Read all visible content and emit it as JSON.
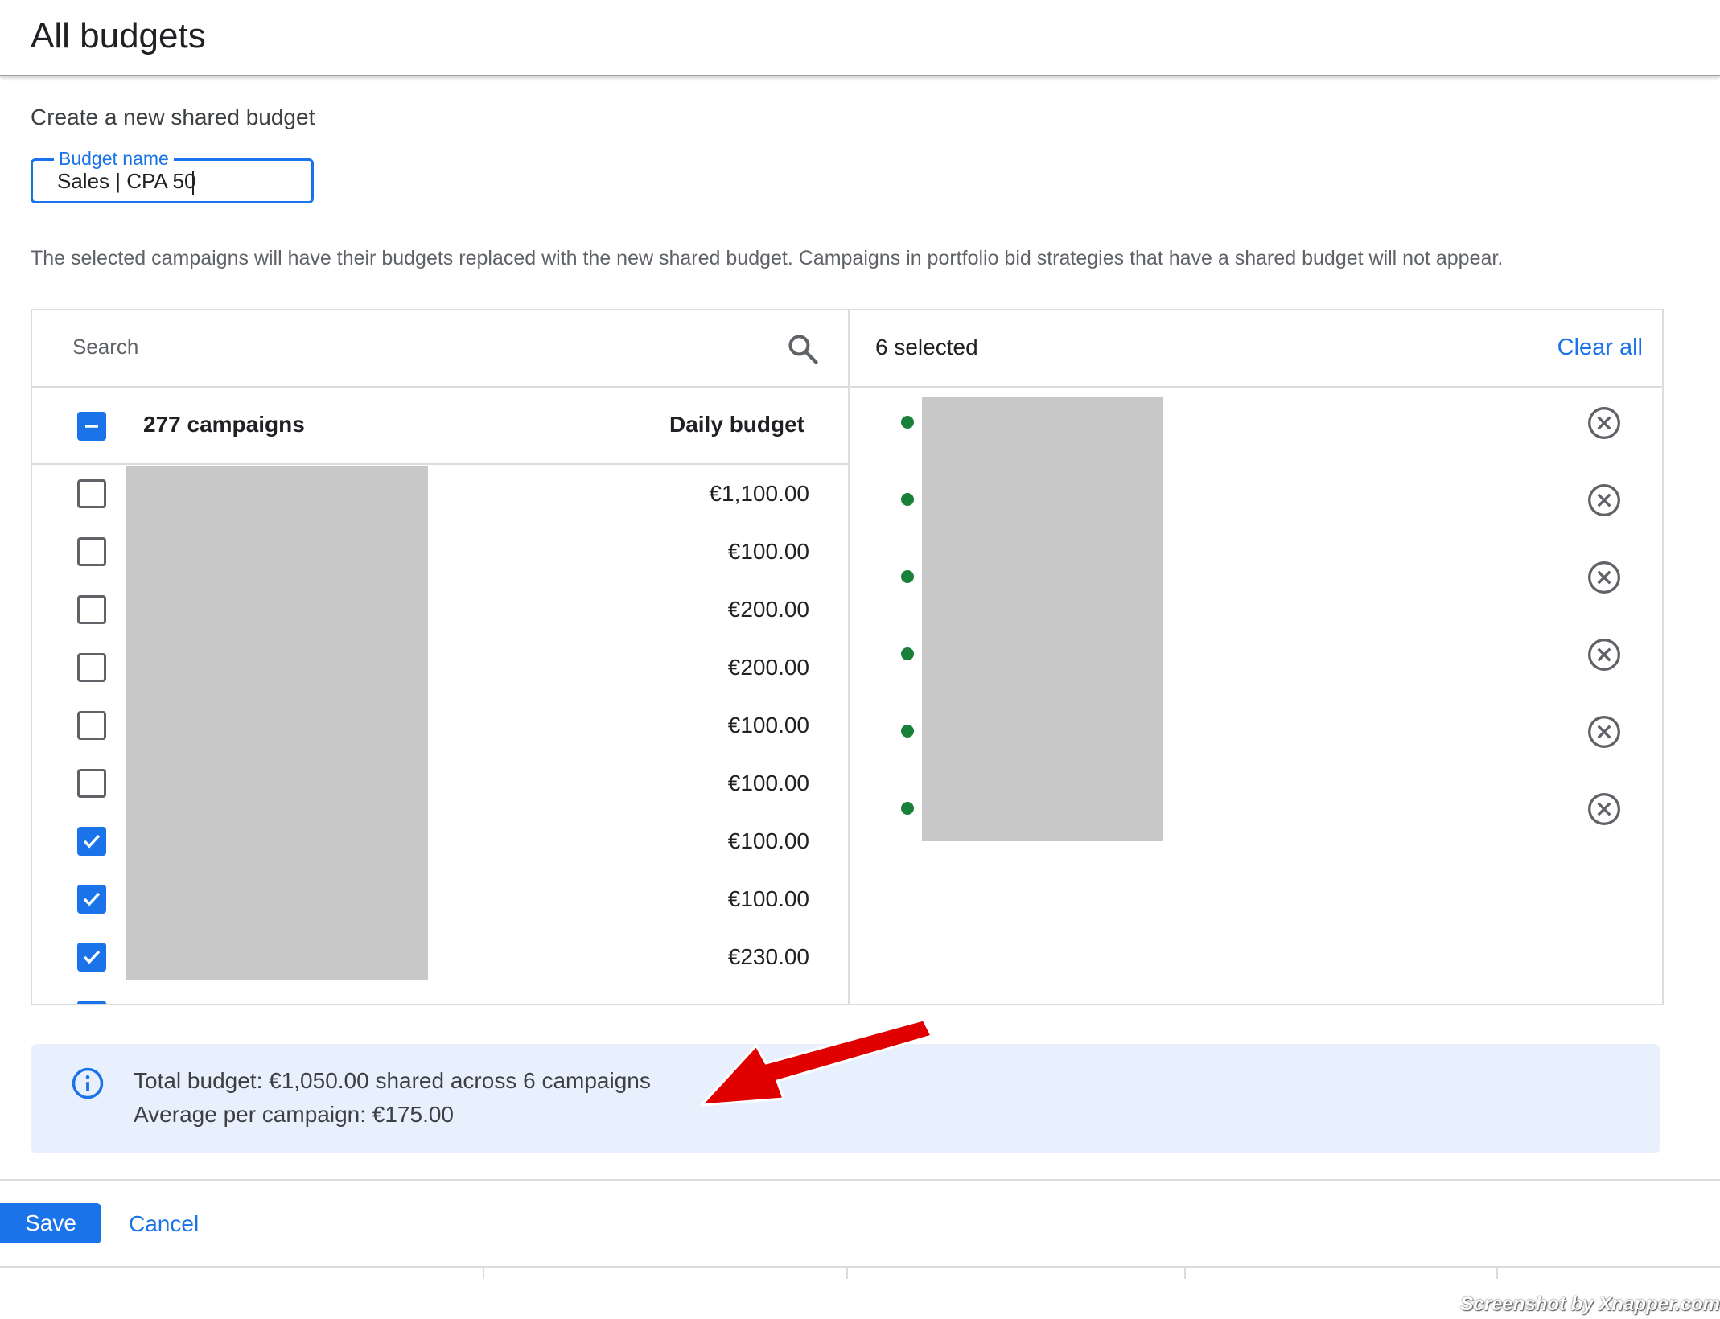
{
  "header": {
    "title": "All budgets"
  },
  "form": {
    "subtitle": "Create a new shared budget",
    "budget_name_label": "Budget name",
    "budget_name_value": "Sales | CPA 50",
    "info_text": "The selected campaigns will have their budgets replaced with the new shared budget. Campaigns in portfolio bid strategies that have a shared budget will not appear."
  },
  "campaign_list": {
    "search_placeholder": "Search",
    "count_label": "277 campaigns",
    "budget_column_label": "Daily budget",
    "rows": [
      {
        "budget": "€1,100.00",
        "checked": false
      },
      {
        "budget": "€100.00",
        "checked": false
      },
      {
        "budget": "€200.00",
        "checked": false
      },
      {
        "budget": "€200.00",
        "checked": false
      },
      {
        "budget": "€100.00",
        "checked": false
      },
      {
        "budget": "€100.00",
        "checked": false
      },
      {
        "budget": "€100.00",
        "checked": true
      },
      {
        "budget": "€100.00",
        "checked": true
      },
      {
        "budget": "€230.00",
        "checked": true
      }
    ]
  },
  "selected_panel": {
    "count_label": "6 selected",
    "clear_all_label": "Clear all",
    "item_count": 6,
    "status_color": "#188038"
  },
  "summary": {
    "line1": "Total budget: €1,050.00 shared across 6 campaigns",
    "line2": "Average per campaign: €175.00"
  },
  "footer": {
    "save_label": "Save",
    "cancel_label": "Cancel"
  },
  "watermark": "Screenshot by Xnapper.com",
  "colors": {
    "accent": "#1a73e8",
    "summary_bg": "#e8f0fe",
    "annotation_arrow": "#e00000"
  }
}
